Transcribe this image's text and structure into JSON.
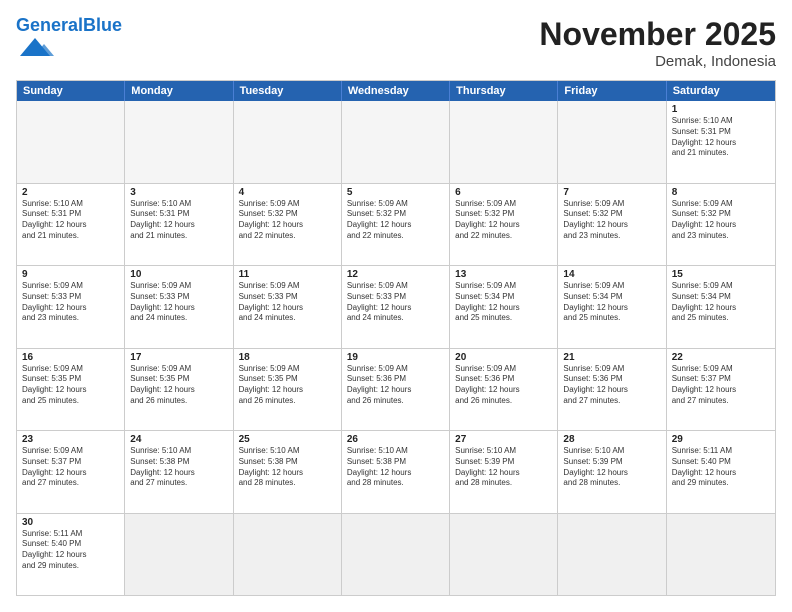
{
  "header": {
    "logo_general": "General",
    "logo_blue": "Blue",
    "title": "November 2025",
    "subtitle": "Demak, Indonesia"
  },
  "days_of_week": [
    "Sunday",
    "Monday",
    "Tuesday",
    "Wednesday",
    "Thursday",
    "Friday",
    "Saturday"
  ],
  "weeks": [
    [
      {
        "day": "",
        "info": ""
      },
      {
        "day": "",
        "info": ""
      },
      {
        "day": "",
        "info": ""
      },
      {
        "day": "",
        "info": ""
      },
      {
        "day": "",
        "info": ""
      },
      {
        "day": "",
        "info": ""
      },
      {
        "day": "1",
        "info": "Sunrise: 5:10 AM\nSunset: 5:31 PM\nDaylight: 12 hours\nand 21 minutes."
      }
    ],
    [
      {
        "day": "2",
        "info": "Sunrise: 5:10 AM\nSunset: 5:31 PM\nDaylight: 12 hours\nand 21 minutes."
      },
      {
        "day": "3",
        "info": "Sunrise: 5:10 AM\nSunset: 5:31 PM\nDaylight: 12 hours\nand 21 minutes."
      },
      {
        "day": "4",
        "info": "Sunrise: 5:09 AM\nSunset: 5:32 PM\nDaylight: 12 hours\nand 22 minutes."
      },
      {
        "day": "5",
        "info": "Sunrise: 5:09 AM\nSunset: 5:32 PM\nDaylight: 12 hours\nand 22 minutes."
      },
      {
        "day": "6",
        "info": "Sunrise: 5:09 AM\nSunset: 5:32 PM\nDaylight: 12 hours\nand 22 minutes."
      },
      {
        "day": "7",
        "info": "Sunrise: 5:09 AM\nSunset: 5:32 PM\nDaylight: 12 hours\nand 23 minutes."
      },
      {
        "day": "8",
        "info": "Sunrise: 5:09 AM\nSunset: 5:32 PM\nDaylight: 12 hours\nand 23 minutes."
      }
    ],
    [
      {
        "day": "9",
        "info": "Sunrise: 5:09 AM\nSunset: 5:33 PM\nDaylight: 12 hours\nand 23 minutes."
      },
      {
        "day": "10",
        "info": "Sunrise: 5:09 AM\nSunset: 5:33 PM\nDaylight: 12 hours\nand 24 minutes."
      },
      {
        "day": "11",
        "info": "Sunrise: 5:09 AM\nSunset: 5:33 PM\nDaylight: 12 hours\nand 24 minutes."
      },
      {
        "day": "12",
        "info": "Sunrise: 5:09 AM\nSunset: 5:33 PM\nDaylight: 12 hours\nand 24 minutes."
      },
      {
        "day": "13",
        "info": "Sunrise: 5:09 AM\nSunset: 5:34 PM\nDaylight: 12 hours\nand 25 minutes."
      },
      {
        "day": "14",
        "info": "Sunrise: 5:09 AM\nSunset: 5:34 PM\nDaylight: 12 hours\nand 25 minutes."
      },
      {
        "day": "15",
        "info": "Sunrise: 5:09 AM\nSunset: 5:34 PM\nDaylight: 12 hours\nand 25 minutes."
      }
    ],
    [
      {
        "day": "16",
        "info": "Sunrise: 5:09 AM\nSunset: 5:35 PM\nDaylight: 12 hours\nand 25 minutes."
      },
      {
        "day": "17",
        "info": "Sunrise: 5:09 AM\nSunset: 5:35 PM\nDaylight: 12 hours\nand 26 minutes."
      },
      {
        "day": "18",
        "info": "Sunrise: 5:09 AM\nSunset: 5:35 PM\nDaylight: 12 hours\nand 26 minutes."
      },
      {
        "day": "19",
        "info": "Sunrise: 5:09 AM\nSunset: 5:36 PM\nDaylight: 12 hours\nand 26 minutes."
      },
      {
        "day": "20",
        "info": "Sunrise: 5:09 AM\nSunset: 5:36 PM\nDaylight: 12 hours\nand 26 minutes."
      },
      {
        "day": "21",
        "info": "Sunrise: 5:09 AM\nSunset: 5:36 PM\nDaylight: 12 hours\nand 27 minutes."
      },
      {
        "day": "22",
        "info": "Sunrise: 5:09 AM\nSunset: 5:37 PM\nDaylight: 12 hours\nand 27 minutes."
      }
    ],
    [
      {
        "day": "23",
        "info": "Sunrise: 5:09 AM\nSunset: 5:37 PM\nDaylight: 12 hours\nand 27 minutes."
      },
      {
        "day": "24",
        "info": "Sunrise: 5:10 AM\nSunset: 5:38 PM\nDaylight: 12 hours\nand 27 minutes."
      },
      {
        "day": "25",
        "info": "Sunrise: 5:10 AM\nSunset: 5:38 PM\nDaylight: 12 hours\nand 28 minutes."
      },
      {
        "day": "26",
        "info": "Sunrise: 5:10 AM\nSunset: 5:38 PM\nDaylight: 12 hours\nand 28 minutes."
      },
      {
        "day": "27",
        "info": "Sunrise: 5:10 AM\nSunset: 5:39 PM\nDaylight: 12 hours\nand 28 minutes."
      },
      {
        "day": "28",
        "info": "Sunrise: 5:10 AM\nSunset: 5:39 PM\nDaylight: 12 hours\nand 28 minutes."
      },
      {
        "day": "29",
        "info": "Sunrise: 5:11 AM\nSunset: 5:40 PM\nDaylight: 12 hours\nand 29 minutes."
      }
    ],
    [
      {
        "day": "30",
        "info": "Sunrise: 5:11 AM\nSunset: 5:40 PM\nDaylight: 12 hours\nand 29 minutes."
      },
      {
        "day": "",
        "info": ""
      },
      {
        "day": "",
        "info": ""
      },
      {
        "day": "",
        "info": ""
      },
      {
        "day": "",
        "info": ""
      },
      {
        "day": "",
        "info": ""
      },
      {
        "day": "",
        "info": ""
      }
    ]
  ]
}
